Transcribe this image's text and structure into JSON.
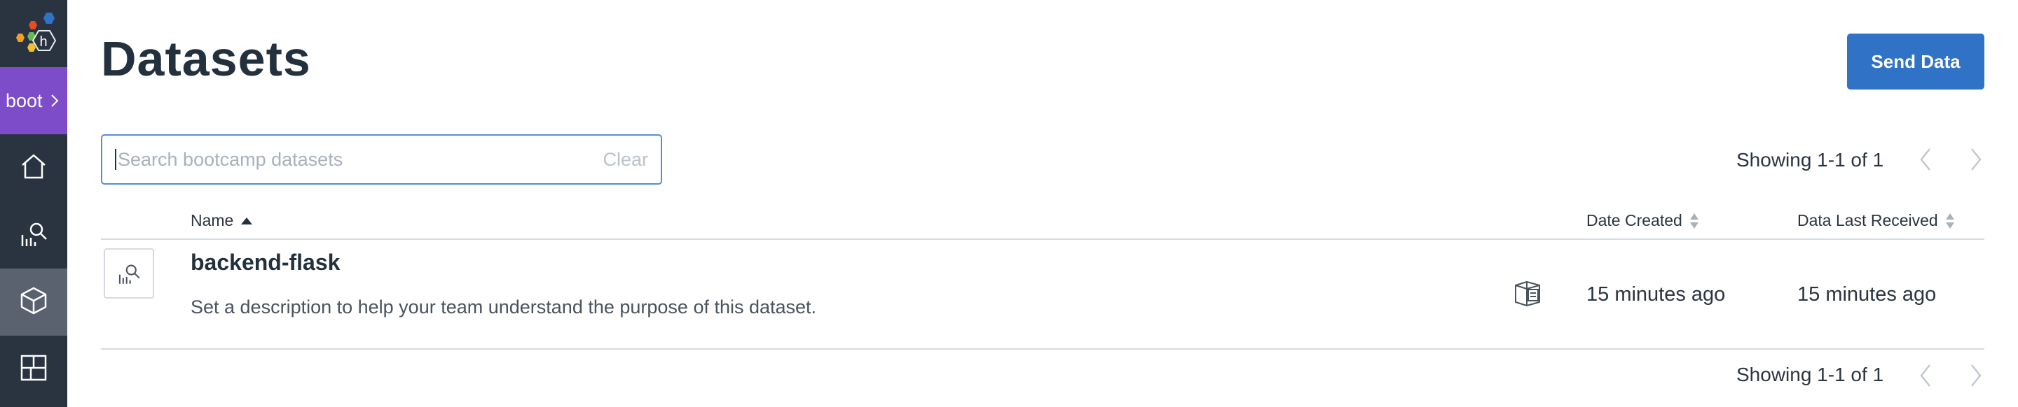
{
  "nav": {
    "environment": "boot",
    "items": [
      {
        "name": "home",
        "icon": "home-icon"
      },
      {
        "name": "query",
        "icon": "query-icon"
      },
      {
        "name": "datasets",
        "icon": "cube-icon",
        "active": true
      },
      {
        "name": "boards",
        "icon": "boards-icon"
      }
    ]
  },
  "header": {
    "title": "Datasets",
    "send_data_label": "Send Data"
  },
  "search": {
    "placeholder": "Search bootcamp datasets",
    "value": "",
    "clear_label": "Clear"
  },
  "pagination": {
    "showing_label": "Showing 1-1 of 1"
  },
  "table": {
    "columns": [
      "Name",
      "Date Created",
      "Data Last Received"
    ],
    "sort": {
      "column": "Name",
      "direction": "ascending"
    },
    "rows": [
      {
        "name": "backend-flask",
        "description": "Set a description to help your team understand the purpose of this dataset.",
        "date_created": "15 minutes ago",
        "data_last_received": "15 minutes ago"
      }
    ]
  },
  "colors": {
    "rail": "#2a3340",
    "environment": "#7d4cc9",
    "active_nav": "#5a6270",
    "primary_button": "#2f72c6",
    "search_border": "#4f8ede"
  }
}
